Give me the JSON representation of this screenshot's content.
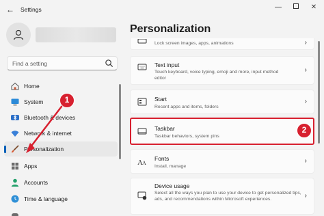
{
  "window": {
    "title": "Settings"
  },
  "search": {
    "placeholder": "Find a setting"
  },
  "sidebar": {
    "items": [
      {
        "label": "Home",
        "icon": "home-icon"
      },
      {
        "label": "System",
        "icon": "monitor-icon"
      },
      {
        "label": "Bluetooth & devices",
        "icon": "bluetooth-icon"
      },
      {
        "label": "Network & internet",
        "icon": "wifi-icon"
      },
      {
        "label": "Personalization",
        "icon": "brush-icon",
        "active": true
      },
      {
        "label": "Apps",
        "icon": "apps-icon"
      },
      {
        "label": "Accounts",
        "icon": "person-icon"
      },
      {
        "label": "Time & language",
        "icon": "globe-clock-icon"
      }
    ]
  },
  "main": {
    "title": "Personalization",
    "cards": [
      {
        "title": "",
        "subtitle": "Lock screen images, apps, animations",
        "icon": "lock-screen-icon"
      },
      {
        "title": "Text input",
        "subtitle": "Touch keyboard, voice typing, emoji and more, input method editor",
        "icon": "keyboard-icon"
      },
      {
        "title": "Start",
        "subtitle": "Recent apps and items, folders",
        "icon": "start-icon"
      },
      {
        "title": "Taskbar",
        "subtitle": "Taskbar behaviors, system pins",
        "icon": "taskbar-icon"
      },
      {
        "title": "Fonts",
        "subtitle": "Install, manage",
        "icon": "fonts-icon"
      },
      {
        "title": "Device usage",
        "subtitle": "Select all the ways you plan to use your device to get personalized tips, ads, and recommendations within Microsoft experiences.",
        "icon": "device-usage-icon"
      }
    ]
  },
  "annotations": {
    "step1": "1",
    "step2": "2",
    "color": "#d7202f"
  },
  "colors": {
    "accent": "#005fb8",
    "background": "#f3f3f3"
  }
}
